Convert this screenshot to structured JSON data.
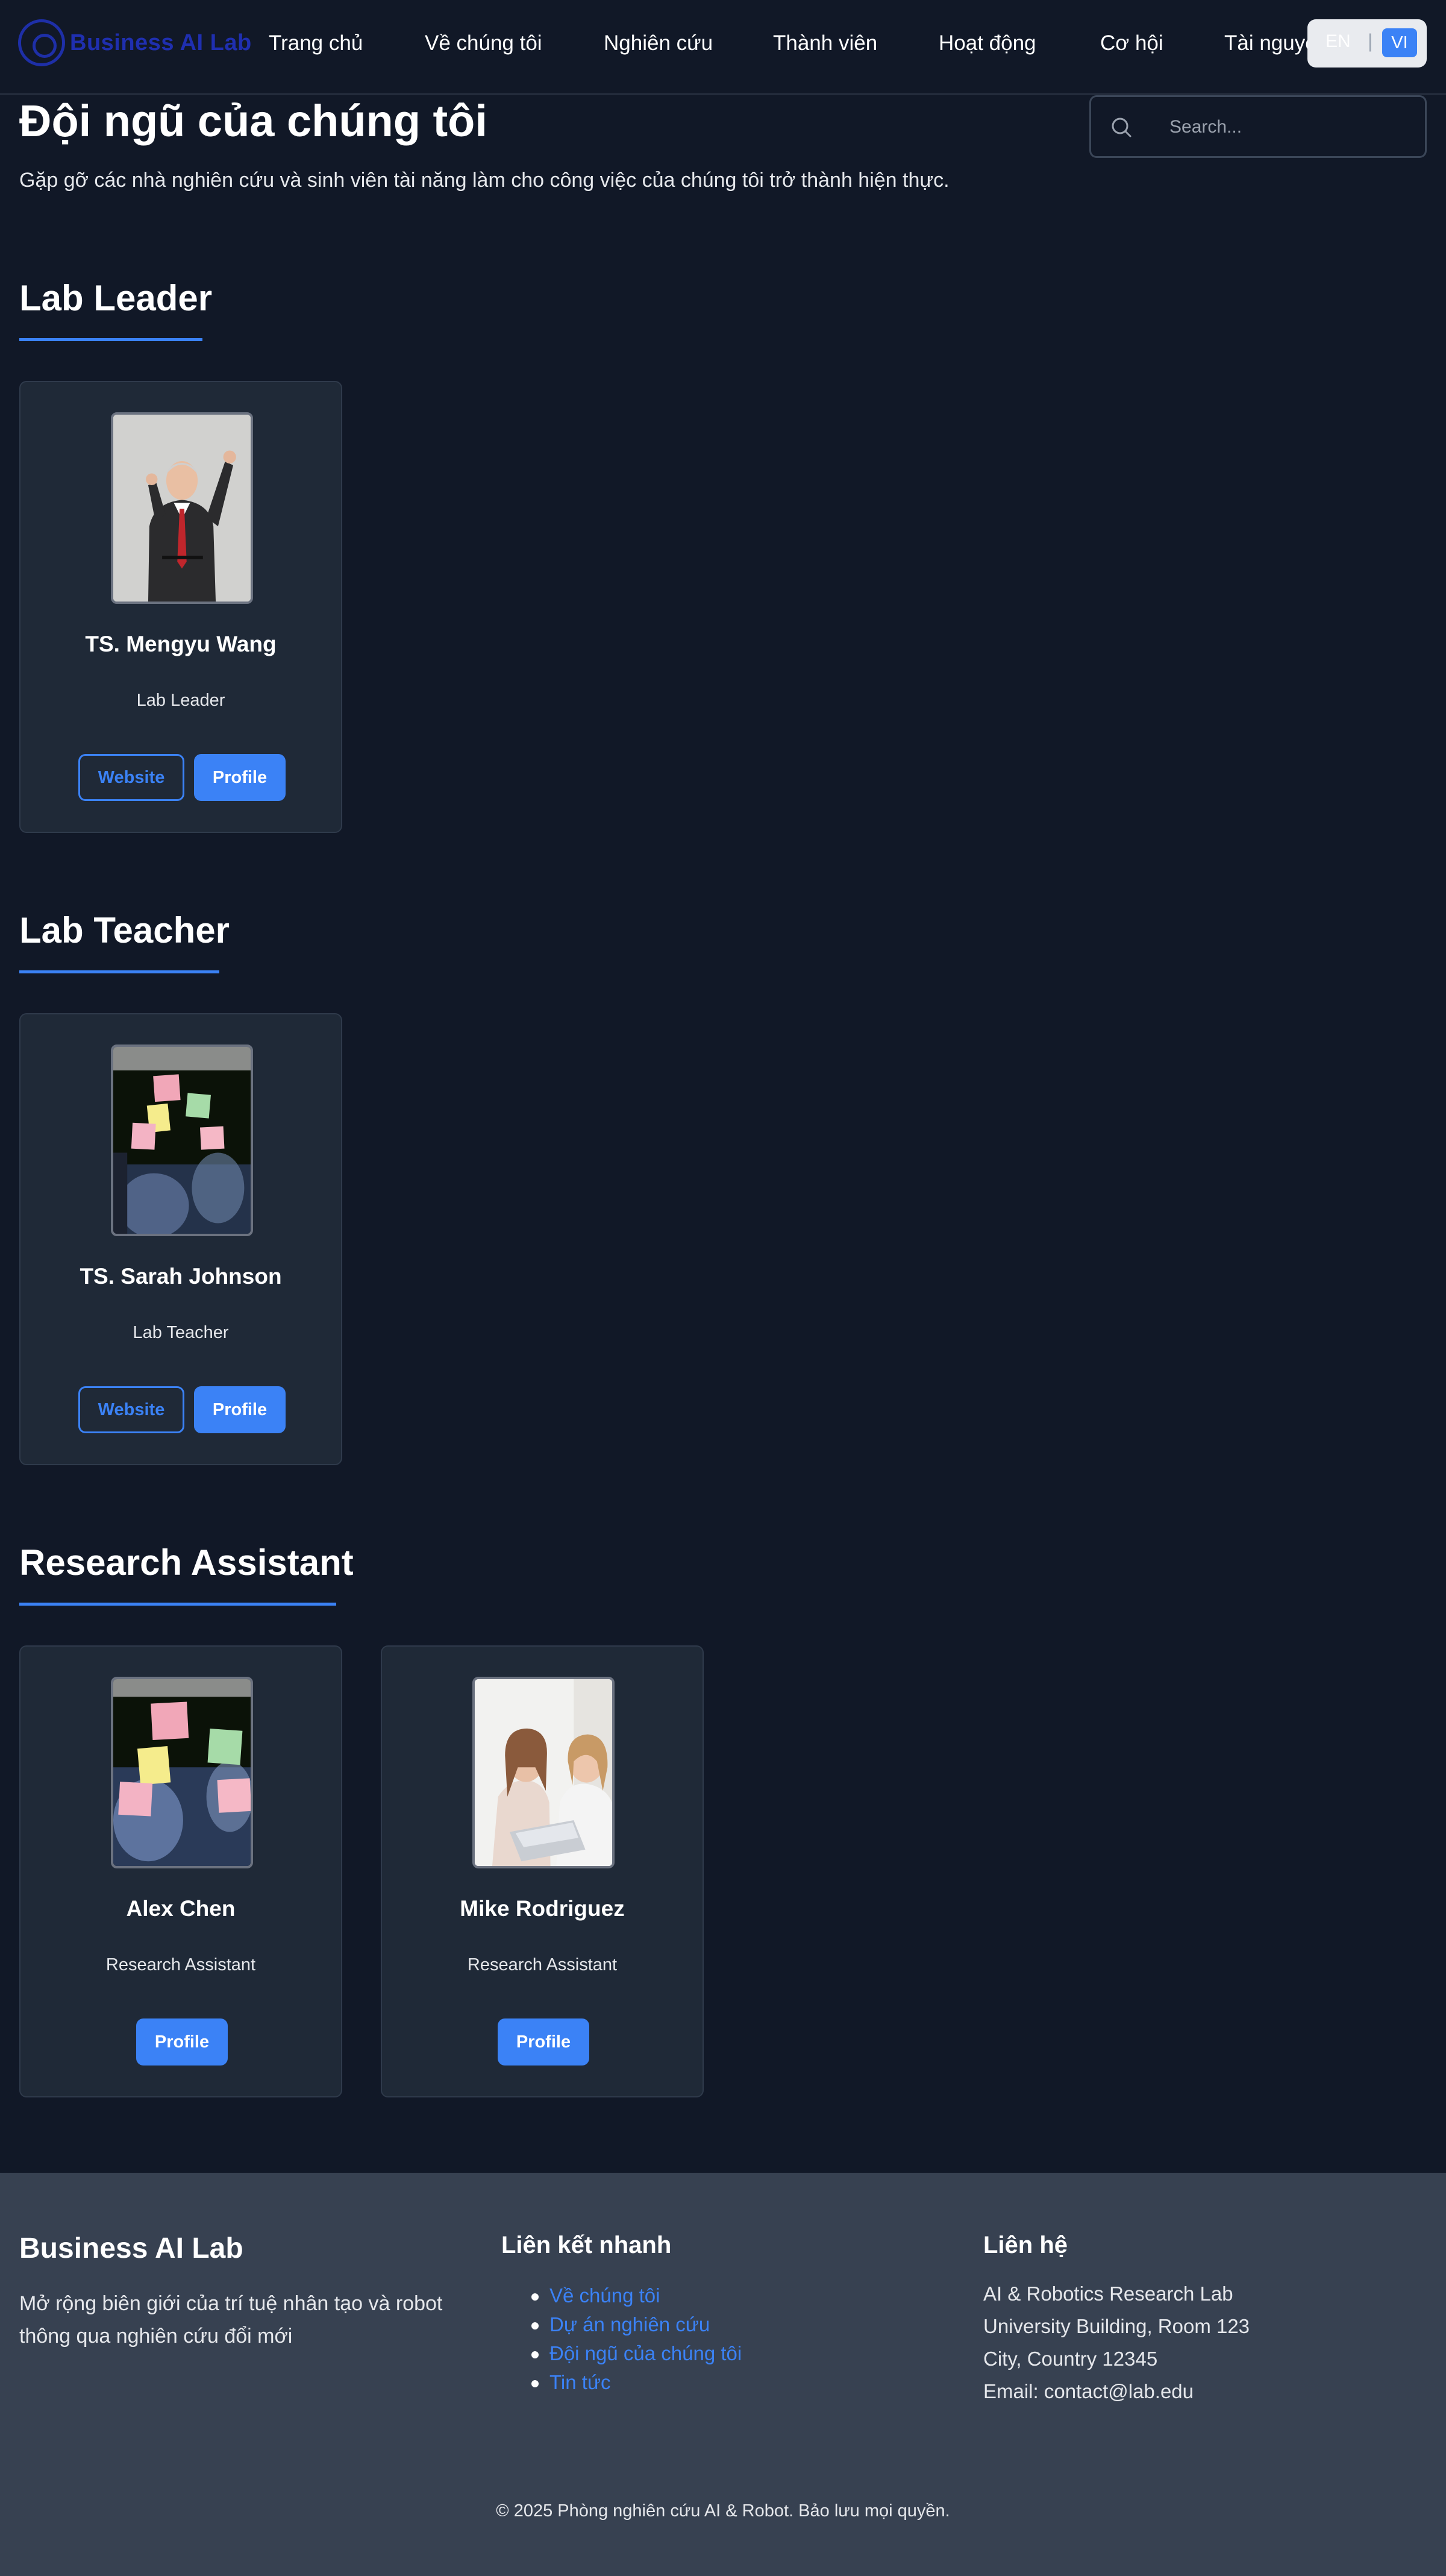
{
  "nav": {
    "logo_text": "Business AI Lab",
    "items": [
      "Trang chủ",
      "Về chúng tôi",
      "Nghiên cứu",
      "Thành viên",
      "Hoạt động",
      "Cơ hội",
      "Tài nguyên"
    ],
    "lang_en": "EN",
    "lang_sep": "|",
    "lang_vi": "VI"
  },
  "header": {
    "title": "Đội ngũ của chúng tôi",
    "subtitle": "Gặp gỡ các nhà nghiên cứu và sinh viên tài năng làm cho công việc của chúng tôi trở thành hiện thực.",
    "search_placeholder": "Search..."
  },
  "sections": [
    {
      "title": "Lab Leader",
      "members": [
        {
          "name": "TS. Mengyu Wang",
          "role": "Lab Leader",
          "website_label": "Website",
          "profile_label": "Profile"
        }
      ]
    },
    {
      "title": "Lab Teacher",
      "members": [
        {
          "name": "TS. Sarah Johnson",
          "role": "Lab Teacher",
          "website_label": "Website",
          "profile_label": "Profile"
        }
      ]
    },
    {
      "title": "Research Assistant",
      "members": [
        {
          "name": "Alex Chen",
          "role": "Research Assistant",
          "profile_label": "Profile"
        },
        {
          "name": "Mike Rodriguez",
          "role": "Research Assistant",
          "profile_label": "Profile"
        }
      ]
    }
  ],
  "footer": {
    "brand": "Business AI Lab",
    "description": "Mở rộng biên giới của trí tuệ nhân tạo và robot thông qua nghiên cứu đổi mới",
    "links_heading": "Liên kết nhanh",
    "links": [
      "Về chúng tôi",
      "Dự án nghiên cứu",
      "Đội ngũ của chúng tôi",
      "Tin tức"
    ],
    "contact_heading": "Liên hệ",
    "contact": [
      "AI & Robotics Research Lab",
      "University Building, Room 123",
      "City, Country 12345",
      "Email: contact@lab.edu"
    ],
    "copyright": "© 2025 Phòng nghiên cứu AI & Robot. Bảo lưu mọi quyền."
  },
  "colors": {
    "background": "#111827",
    "card": "#1f2937",
    "accent": "#3b82f6",
    "footer": "#374151",
    "logo": "#1f2fb0"
  },
  "icons": [
    "search-icon",
    "logo-icon"
  ]
}
